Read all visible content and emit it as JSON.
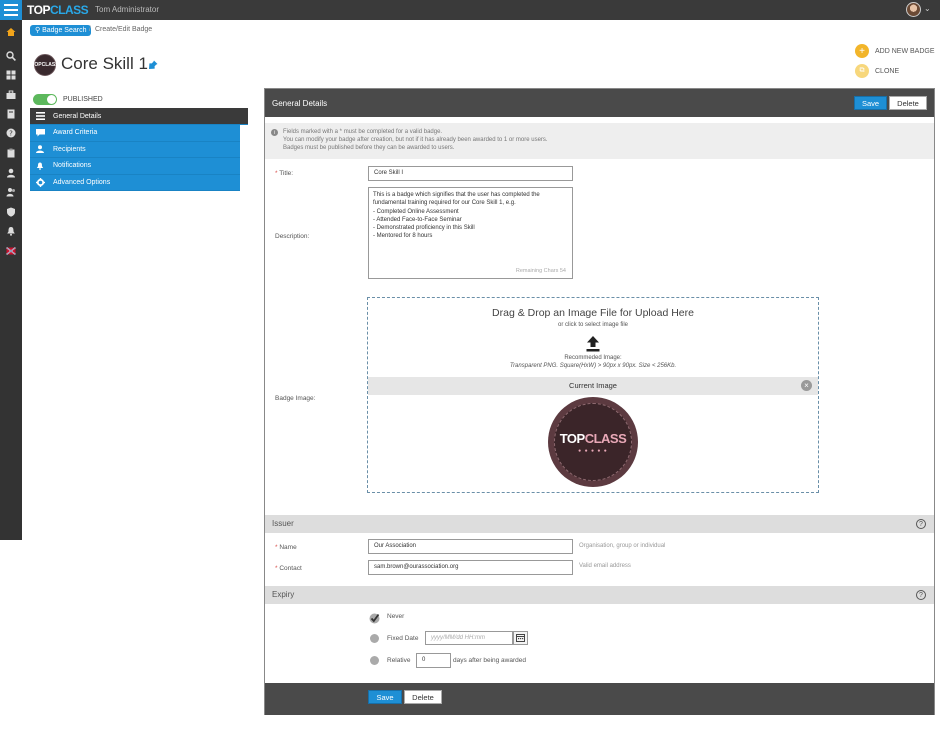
{
  "app": {
    "logo_top": "TOP",
    "logo_class": "CLASS",
    "user": "Tom Administrator"
  },
  "breadcrumb": {
    "back_label": "Badge Search",
    "current": "Create/Edit Badge"
  },
  "badge": {
    "thumb_text": "TOPCLASS",
    "title": "Core Skill 1"
  },
  "actions": {
    "add_label": "ADD NEW BADGE",
    "clone_label": "CLONE"
  },
  "status": {
    "label": "PUBLISHED",
    "published": true
  },
  "submenu": [
    {
      "label": "General Details",
      "icon": "list-icon"
    },
    {
      "label": "Award Criteria",
      "icon": "chat-icon"
    },
    {
      "label": "Recipients",
      "icon": "user-icon"
    },
    {
      "label": "Notifications",
      "icon": "bell-icon"
    },
    {
      "label": "Advanced Options",
      "icon": "gear-icon"
    }
  ],
  "panel": {
    "title": "General Details",
    "save_label": "Save",
    "delete_label": "Delete",
    "info_lines": [
      "Fields marked with a * must be completed for a valid badge.",
      "You can modify your badge after creation, but not if it has already been awarded to 1 or more users.",
      "Badges must be published before they can be awarded to users."
    ]
  },
  "form": {
    "title_label": "Title:",
    "title_value": "Core Skill I",
    "description_label": "Description:",
    "description_lines": [
      "This is a badge which signifies that the user has completed the",
      "fundamental training required for our Core Skill 1, e.g.",
      "- Completed Online Assessment",
      "- Attended Face-to-Face Seminar",
      "- Demonstrated proficiency in this Skill",
      "- Mentored for 8 hours"
    ],
    "remaining_chars": "Remaining Chars 54",
    "badge_image_label": "Badge Image:",
    "drop_title": "Drag & Drop an Image File for Upload Here",
    "drop_sub": "or click to select image file",
    "recommended_label": "Recommeded Image:",
    "recommended_spec": "Transparent PNG. Square(HxW) > 90px x 90px. Size < 256Kb.",
    "current_image_label": "Current Image",
    "current_badge_text_a": "TOP",
    "current_badge_text_b": "CLASS"
  },
  "issuer": {
    "section_title": "Issuer",
    "name_label": "Name",
    "name_value": "Our Association",
    "name_hint": "Organisation, group or individual",
    "contact_label": "Contact",
    "contact_value": "sam.brown@ourassociation.org",
    "contact_hint": "Valid email address"
  },
  "expiry": {
    "section_title": "Expiry",
    "never_label": "Never",
    "fixed_label": "Fixed Date",
    "fixed_placeholder": "yyyy/MM/dd HH:mm",
    "relative_label": "Relative",
    "relative_value": "0",
    "relative_suffix": "days after being awarded",
    "selected": "Never"
  },
  "footer": {
    "save_label": "Save",
    "delete_label": "Delete"
  },
  "colors": {
    "accent": "#1e8fd5",
    "dark": "#3a3a3a",
    "toggle_on": "#5cb85c",
    "action": "#f2b52a"
  }
}
